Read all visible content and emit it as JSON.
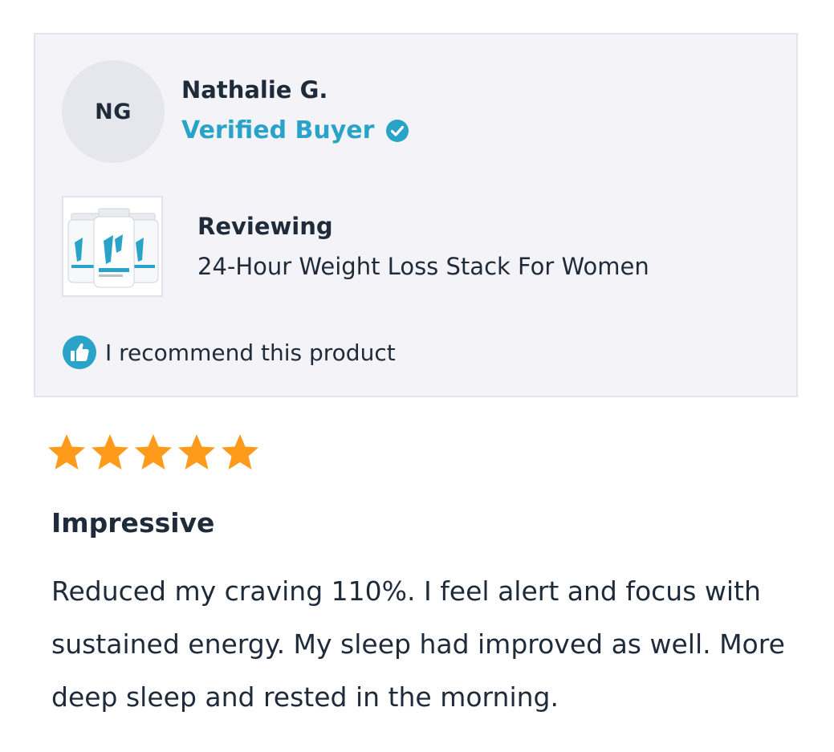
{
  "reviewer": {
    "initials": "NG",
    "name": "Nathalie G.",
    "badge": "Verified Buyer",
    "badge_icon": "check-circle-icon"
  },
  "product": {
    "reviewing_label": "Reviewing",
    "name": "24-Hour Weight Loss Stack For Women",
    "thumbnail": "product-bottles-image"
  },
  "recommendation": {
    "icon": "thumbs-up-icon",
    "text": "I recommend this product"
  },
  "rating": {
    "value": 5,
    "max": 5,
    "star_color": "#ff9a1a"
  },
  "review": {
    "title": "Impressive",
    "body": "Reduced my craving 110%. I feel alert and focus with sustained energy. My sleep had improved as well. More deep sleep and rested in the morning."
  },
  "colors": {
    "accent": "#2aa3c9",
    "text": "#1f2b3a",
    "card_bg": "#f4f4f8"
  }
}
